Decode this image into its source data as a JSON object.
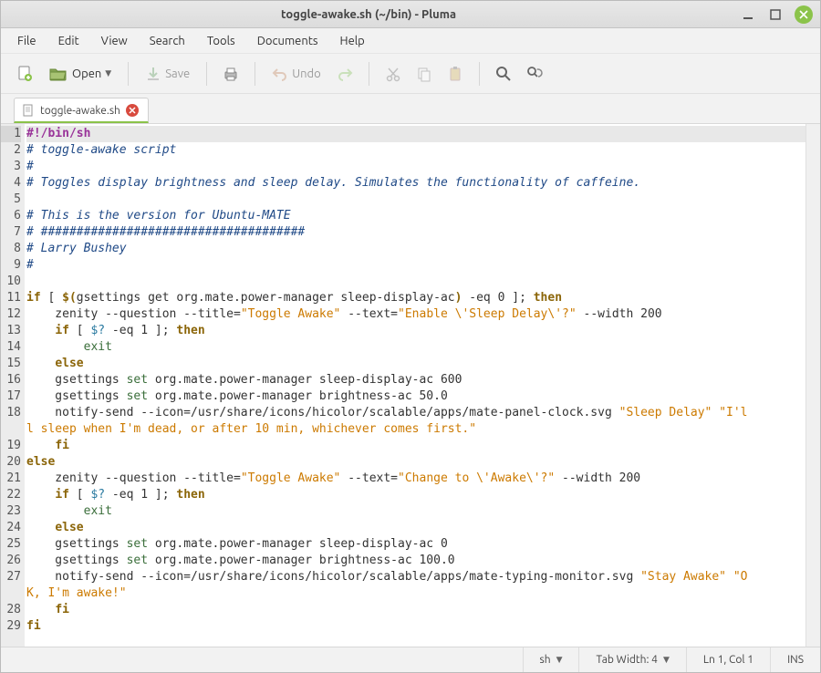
{
  "window": {
    "title": "toggle-awake.sh (~/bin) - Pluma"
  },
  "menu": {
    "items": [
      "File",
      "Edit",
      "View",
      "Search",
      "Tools",
      "Documents",
      "Help"
    ]
  },
  "toolbar": {
    "open_label": "Open",
    "save_label": "Save",
    "undo_label": "Undo"
  },
  "tab": {
    "label": "toggle-awake.sh"
  },
  "code": {
    "lines": [
      [
        [
          "shebang",
          "#!/bin/sh"
        ]
      ],
      [
        [
          "comment",
          "# toggle-awake script"
        ]
      ],
      [
        [
          "comment",
          "#"
        ]
      ],
      [
        [
          "comment",
          "# Toggles display brightness and sleep delay. Simulates the functionality of caffeine."
        ]
      ],
      [],
      [
        [
          "comment",
          "# This is the version for Ubuntu-MATE"
        ]
      ],
      [
        [
          "comment",
          "# #####################################"
        ]
      ],
      [
        [
          "comment",
          "# Larry Bushey"
        ]
      ],
      [
        [
          "comment",
          "#"
        ]
      ],
      [],
      [
        [
          "kw",
          "if"
        ],
        [
          "plain",
          " [ "
        ],
        [
          "kw",
          "$("
        ],
        [
          "plain",
          "gsettings get org.mate.power-manager sleep-display-ac"
        ],
        [
          "kw",
          ")"
        ],
        [
          "plain",
          " -eq 0 ]; "
        ],
        [
          "kw",
          "then"
        ]
      ],
      [
        [
          "plain",
          "    zenity --question --title="
        ],
        [
          "str",
          "\"Toggle Awake\""
        ],
        [
          "plain",
          " --text="
        ],
        [
          "str",
          "\"Enable \\'Sleep Delay\\'?\""
        ],
        [
          "plain",
          " --width 200"
        ]
      ],
      [
        [
          "plain",
          "    "
        ],
        [
          "kw",
          "if"
        ],
        [
          "plain",
          " [ "
        ],
        [
          "var",
          "$?"
        ],
        [
          "plain",
          " -eq 1 ]; "
        ],
        [
          "kw",
          "then"
        ]
      ],
      [
        [
          "plain",
          "        "
        ],
        [
          "builtin",
          "exit"
        ]
      ],
      [
        [
          "plain",
          "    "
        ],
        [
          "kw",
          "else"
        ]
      ],
      [
        [
          "plain",
          "    gsettings "
        ],
        [
          "builtin",
          "set"
        ],
        [
          "plain",
          " org.mate.power-manager sleep-display-ac 600"
        ]
      ],
      [
        [
          "plain",
          "    gsettings "
        ],
        [
          "builtin",
          "set"
        ],
        [
          "plain",
          " org.mate.power-manager brightness-ac 50.0"
        ]
      ],
      [
        [
          "plain",
          "    notify-send --icon=/usr/share/icons/hicolor/scalable/apps/mate-panel-clock.svg "
        ],
        [
          "str",
          "\"Sleep Delay\""
        ],
        [
          "plain",
          " "
        ],
        [
          "str",
          "\"I'll sleep when I'm dead, or after 10 min, whichever comes first.\""
        ]
      ],
      [
        [
          "plain",
          "    "
        ],
        [
          "kw",
          "fi"
        ]
      ],
      [
        [
          "kw",
          "else"
        ]
      ],
      [
        [
          "plain",
          "    zenity --question --title="
        ],
        [
          "str",
          "\"Toggle Awake\""
        ],
        [
          "plain",
          " --text="
        ],
        [
          "str",
          "\"Change to \\'Awake\\'?\""
        ],
        [
          "plain",
          " --width 200"
        ]
      ],
      [
        [
          "plain",
          "    "
        ],
        [
          "kw",
          "if"
        ],
        [
          "plain",
          " [ "
        ],
        [
          "var",
          "$?"
        ],
        [
          "plain",
          " -eq 1 ]; "
        ],
        [
          "kw",
          "then"
        ]
      ],
      [
        [
          "plain",
          "        "
        ],
        [
          "builtin",
          "exit"
        ]
      ],
      [
        [
          "plain",
          "    "
        ],
        [
          "kw",
          "else"
        ]
      ],
      [
        [
          "plain",
          "    gsettings "
        ],
        [
          "builtin",
          "set"
        ],
        [
          "plain",
          " org.mate.power-manager sleep-display-ac 0"
        ]
      ],
      [
        [
          "plain",
          "    gsettings "
        ],
        [
          "builtin",
          "set"
        ],
        [
          "plain",
          " org.mate.power-manager brightness-ac 100.0"
        ]
      ],
      [
        [
          "plain",
          "    notify-send --icon=/usr/share/icons/hicolor/scalable/apps/mate-typing-monitor.svg "
        ],
        [
          "str",
          "\"Stay Awake\""
        ],
        [
          "plain",
          " "
        ],
        [
          "str",
          "\"OK, I'm awake!\""
        ]
      ],
      [
        [
          "plain",
          "    "
        ],
        [
          "kw",
          "fi"
        ]
      ],
      [
        [
          "kw",
          "fi"
        ]
      ]
    ],
    "wrap_indices": [
      17,
      26
    ]
  },
  "status": {
    "lang": "sh",
    "tabwidth": "Tab Width: 4",
    "cursor": "Ln 1, Col 1",
    "mode": "INS"
  }
}
